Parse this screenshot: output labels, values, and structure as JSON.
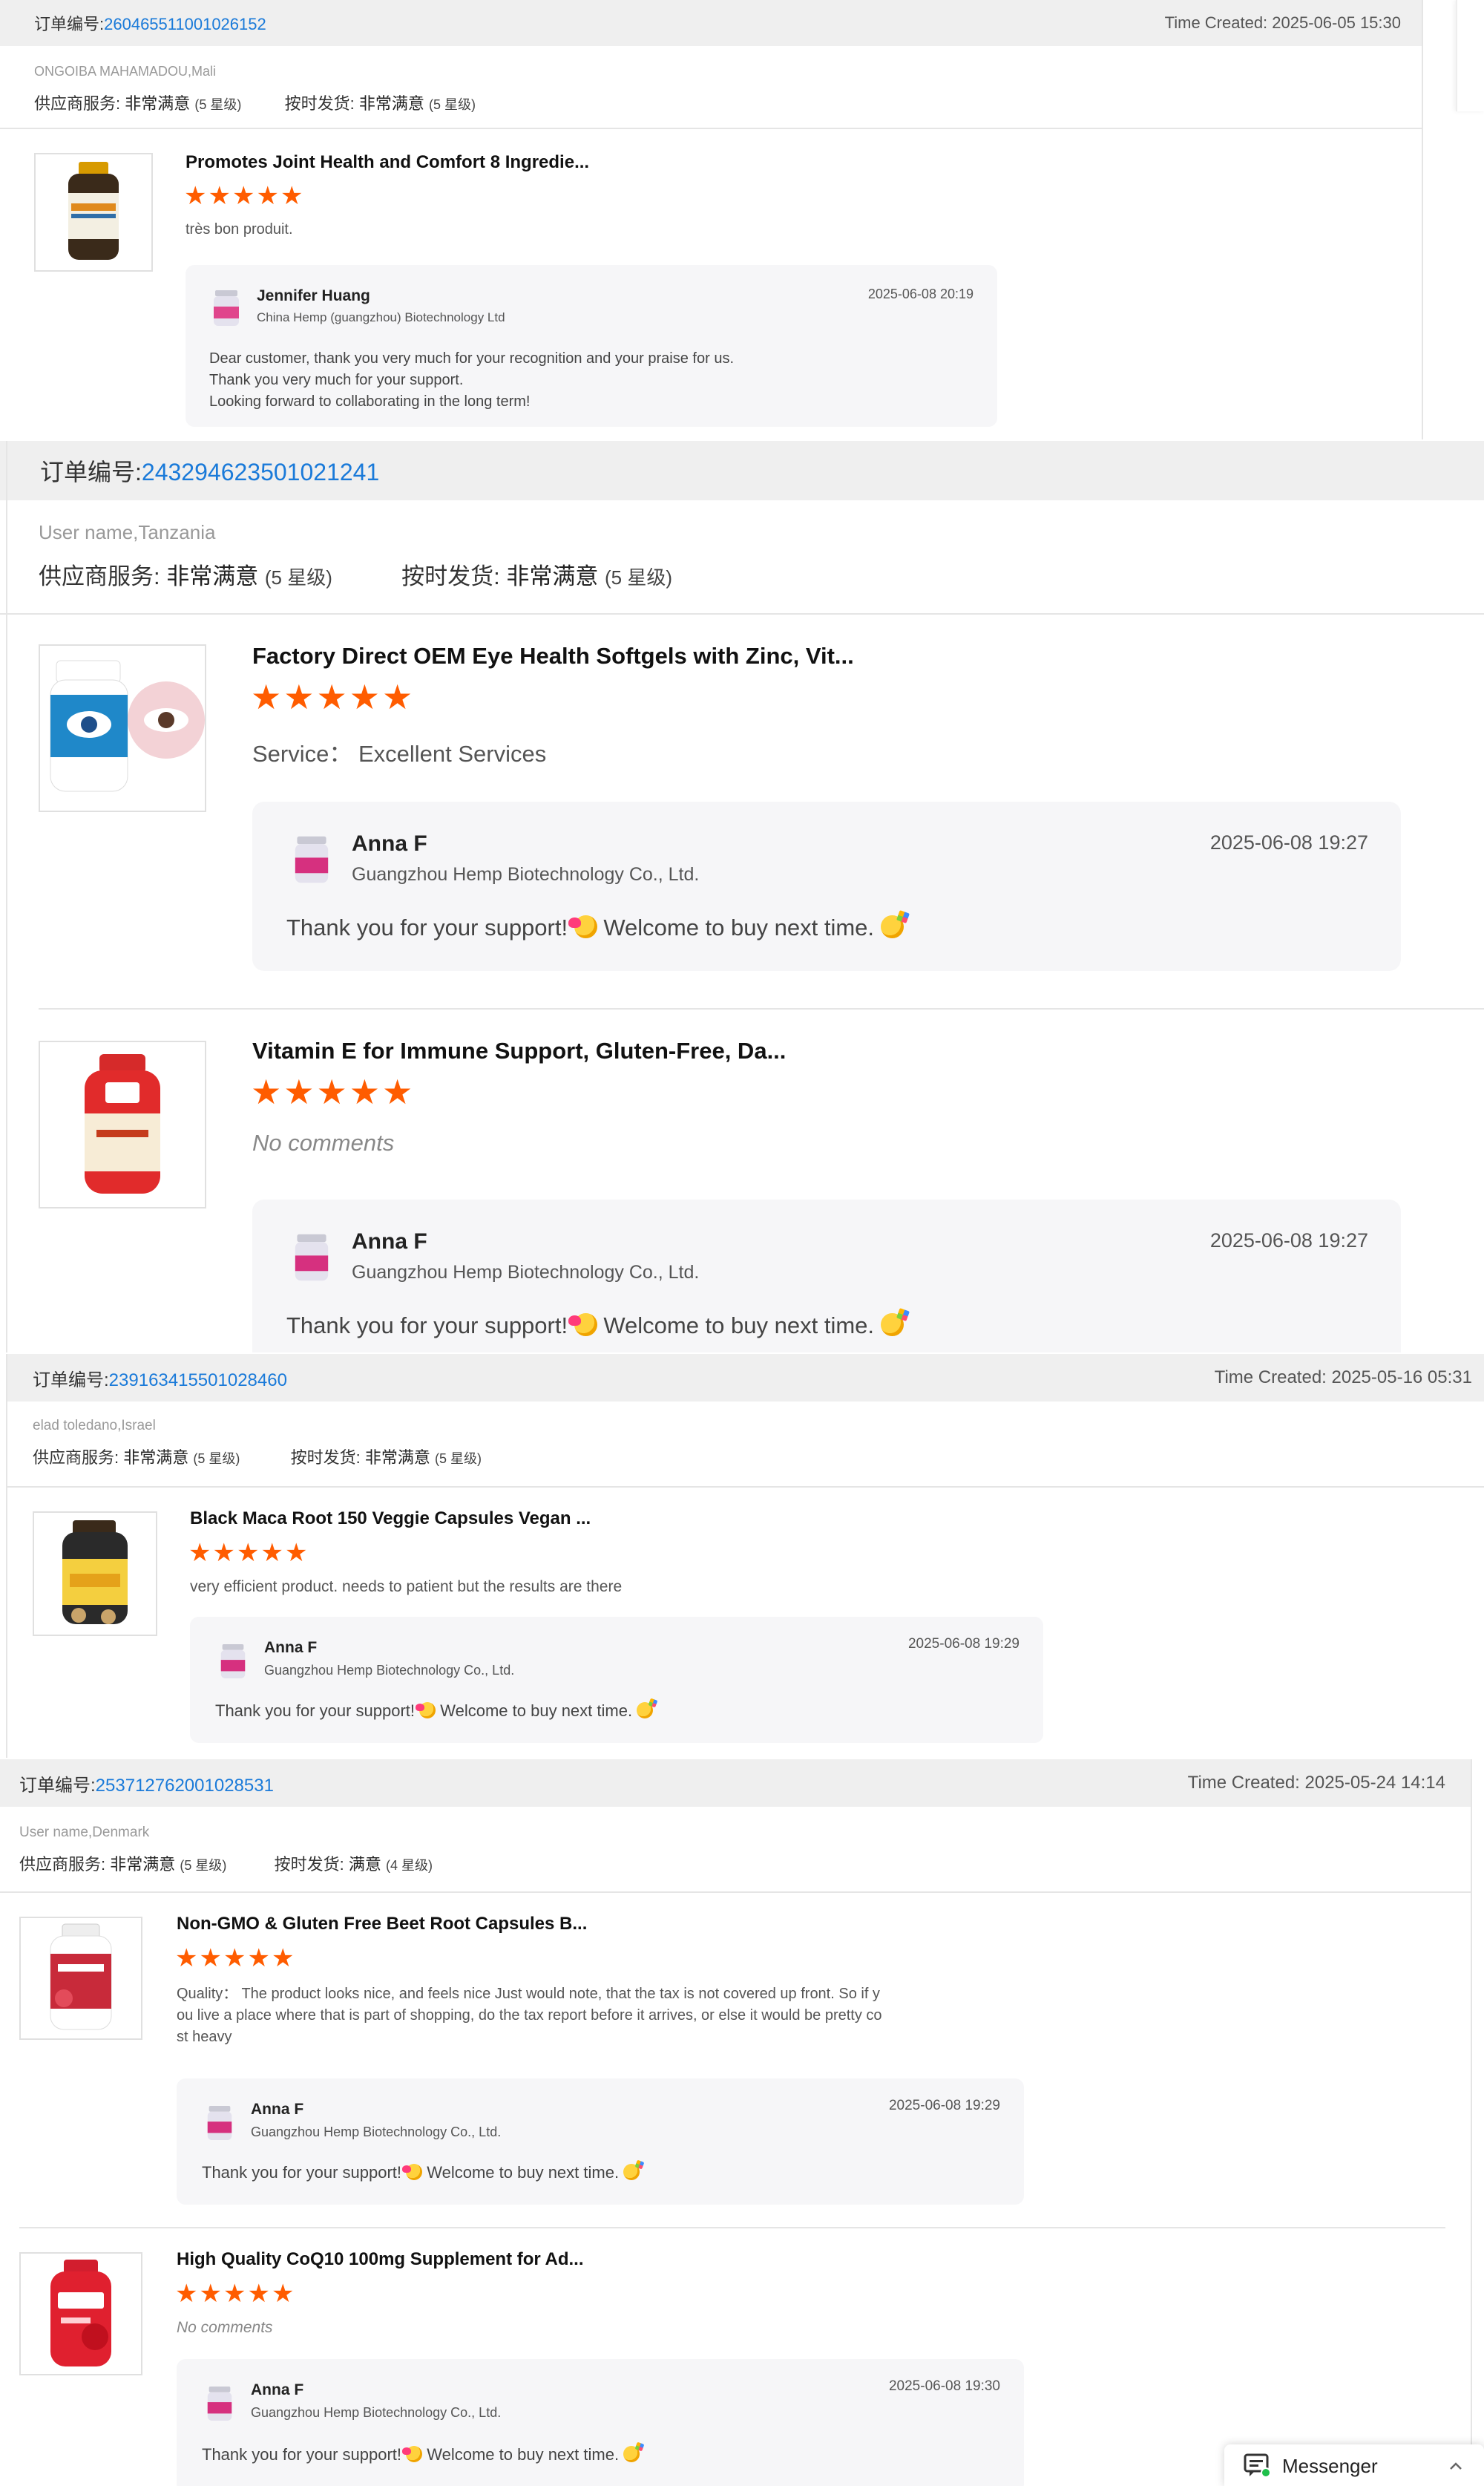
{
  "labels": {
    "order_no": "订单编号:",
    "time_created": "Time Created: ",
    "supplier_service": "供应商服务:",
    "on_time_shipping": "按时发货:",
    "no_comments": "No comments",
    "rating_max_stars": 5
  },
  "orders": [
    {
      "number": "260465511001026152",
      "time_created": "2025-06-05 15:30",
      "buyer": "ONGOIBA MAHAMADOU,Mali",
      "supplier_value": "非常满意",
      "supplier_level": "(5 星级)",
      "shipping_value": "非常满意",
      "shipping_level": "(5 星级)",
      "items": [
        {
          "title": "Promotes Joint Health and Comfort 8 Ingredie...",
          "rating": 5,
          "review": "très bon produit.",
          "reply": {
            "name": "Jennifer Huang",
            "company": "China Hemp (guangzhou) Biotechnology Ltd",
            "date": "2025-06-08 20:19",
            "lines": [
              "Dear customer, thank you very much for your recognition and your praise for us.",
              "Thank you very much for your support.",
              "Looking forward to collaborating in the long term!"
            ]
          }
        }
      ]
    },
    {
      "number": "243294623501021241",
      "buyer": "User name,Tanzania",
      "supplier_value": "非常满意",
      "supplier_level": "(5 星级)",
      "shipping_value": "非常满意",
      "shipping_level": "(5 星级)",
      "items": [
        {
          "title": "Factory Direct OEM Eye Health Softgels with Zinc, Vit...",
          "rating": 5,
          "review": "Service：  Excellent Services",
          "reply": {
            "name": "Anna F",
            "company": "Guangzhou Hemp Biotechnology Co., Ltd.",
            "date": "2025-06-08 19:27",
            "msg_a": "Thank you for your support! ",
            "msg_b": " Welcome to buy next time. "
          }
        },
        {
          "title": "Vitamin E for Immune Support, Gluten-Free, Da...",
          "rating": 5,
          "review": "No comments",
          "reply": {
            "name": "Anna F",
            "company": "Guangzhou Hemp Biotechnology Co., Ltd.",
            "date": "2025-06-08 19:27",
            "msg_a": "Thank you for your support! ",
            "msg_b": " Welcome to buy next time. "
          }
        }
      ]
    },
    {
      "number": "239163415501028460",
      "time_created": "2025-05-16 05:31",
      "buyer": "elad toledano,Israel",
      "supplier_value": "非常满意",
      "supplier_level": "(5 星级)",
      "shipping_value": "非常满意",
      "shipping_level": "(5 星级)",
      "items": [
        {
          "title": "Black Maca Root 150 Veggie Capsules Vegan ...",
          "rating": 5,
          "review": "very efficient product.  needs to patient but the results are there",
          "reply": {
            "name": "Anna F",
            "company": "Guangzhou Hemp Biotechnology Co., Ltd.",
            "date": "2025-06-08 19:29",
            "msg_a": "Thank you for your support! ",
            "msg_b": " Welcome to buy next time. "
          }
        }
      ]
    },
    {
      "number": "253712762001028531",
      "time_created": "2025-05-24 14:14",
      "buyer": "User name,Denmark",
      "supplier_value": "非常满意",
      "supplier_level": "(5 星级)",
      "shipping_value": "满意",
      "shipping_level": "(4 星级)",
      "items": [
        {
          "title": "Non-GMO & Gluten Free Beet Root Capsules B...",
          "rating": 5,
          "review_lines": [
            "Quality：  The product looks nice, and feels nice Just would note, that the tax is not covered up front. So if y",
            "ou live a place where that is part of shopping, do the tax report before it arrives, or else it would be pretty co",
            "st heavy"
          ],
          "reply": {
            "name": "Anna F",
            "company": "Guangzhou Hemp Biotechnology Co., Ltd.",
            "date": "2025-06-08 19:29",
            "msg_a": "Thank you for your support! ",
            "msg_b": " Welcome to buy next time. "
          }
        },
        {
          "title": "High Quality CoQ10 100mg Supplement for Ad...",
          "rating": 5,
          "review": "No comments",
          "reply": {
            "name": "Anna F",
            "company": "Guangzhou Hemp Biotechnology Co., Ltd.",
            "date": "2025-06-08 19:30",
            "msg_a": "Thank you for your support! ",
            "msg_b": " Welcome to buy next time. "
          }
        }
      ]
    }
  ],
  "messenger": {
    "label": "Messenger"
  },
  "colors": {
    "accent_link": "#1a7ad9",
    "star": "#ff5c00",
    "header_bg": "#efefef",
    "reply_bg": "#f6f6f8"
  }
}
